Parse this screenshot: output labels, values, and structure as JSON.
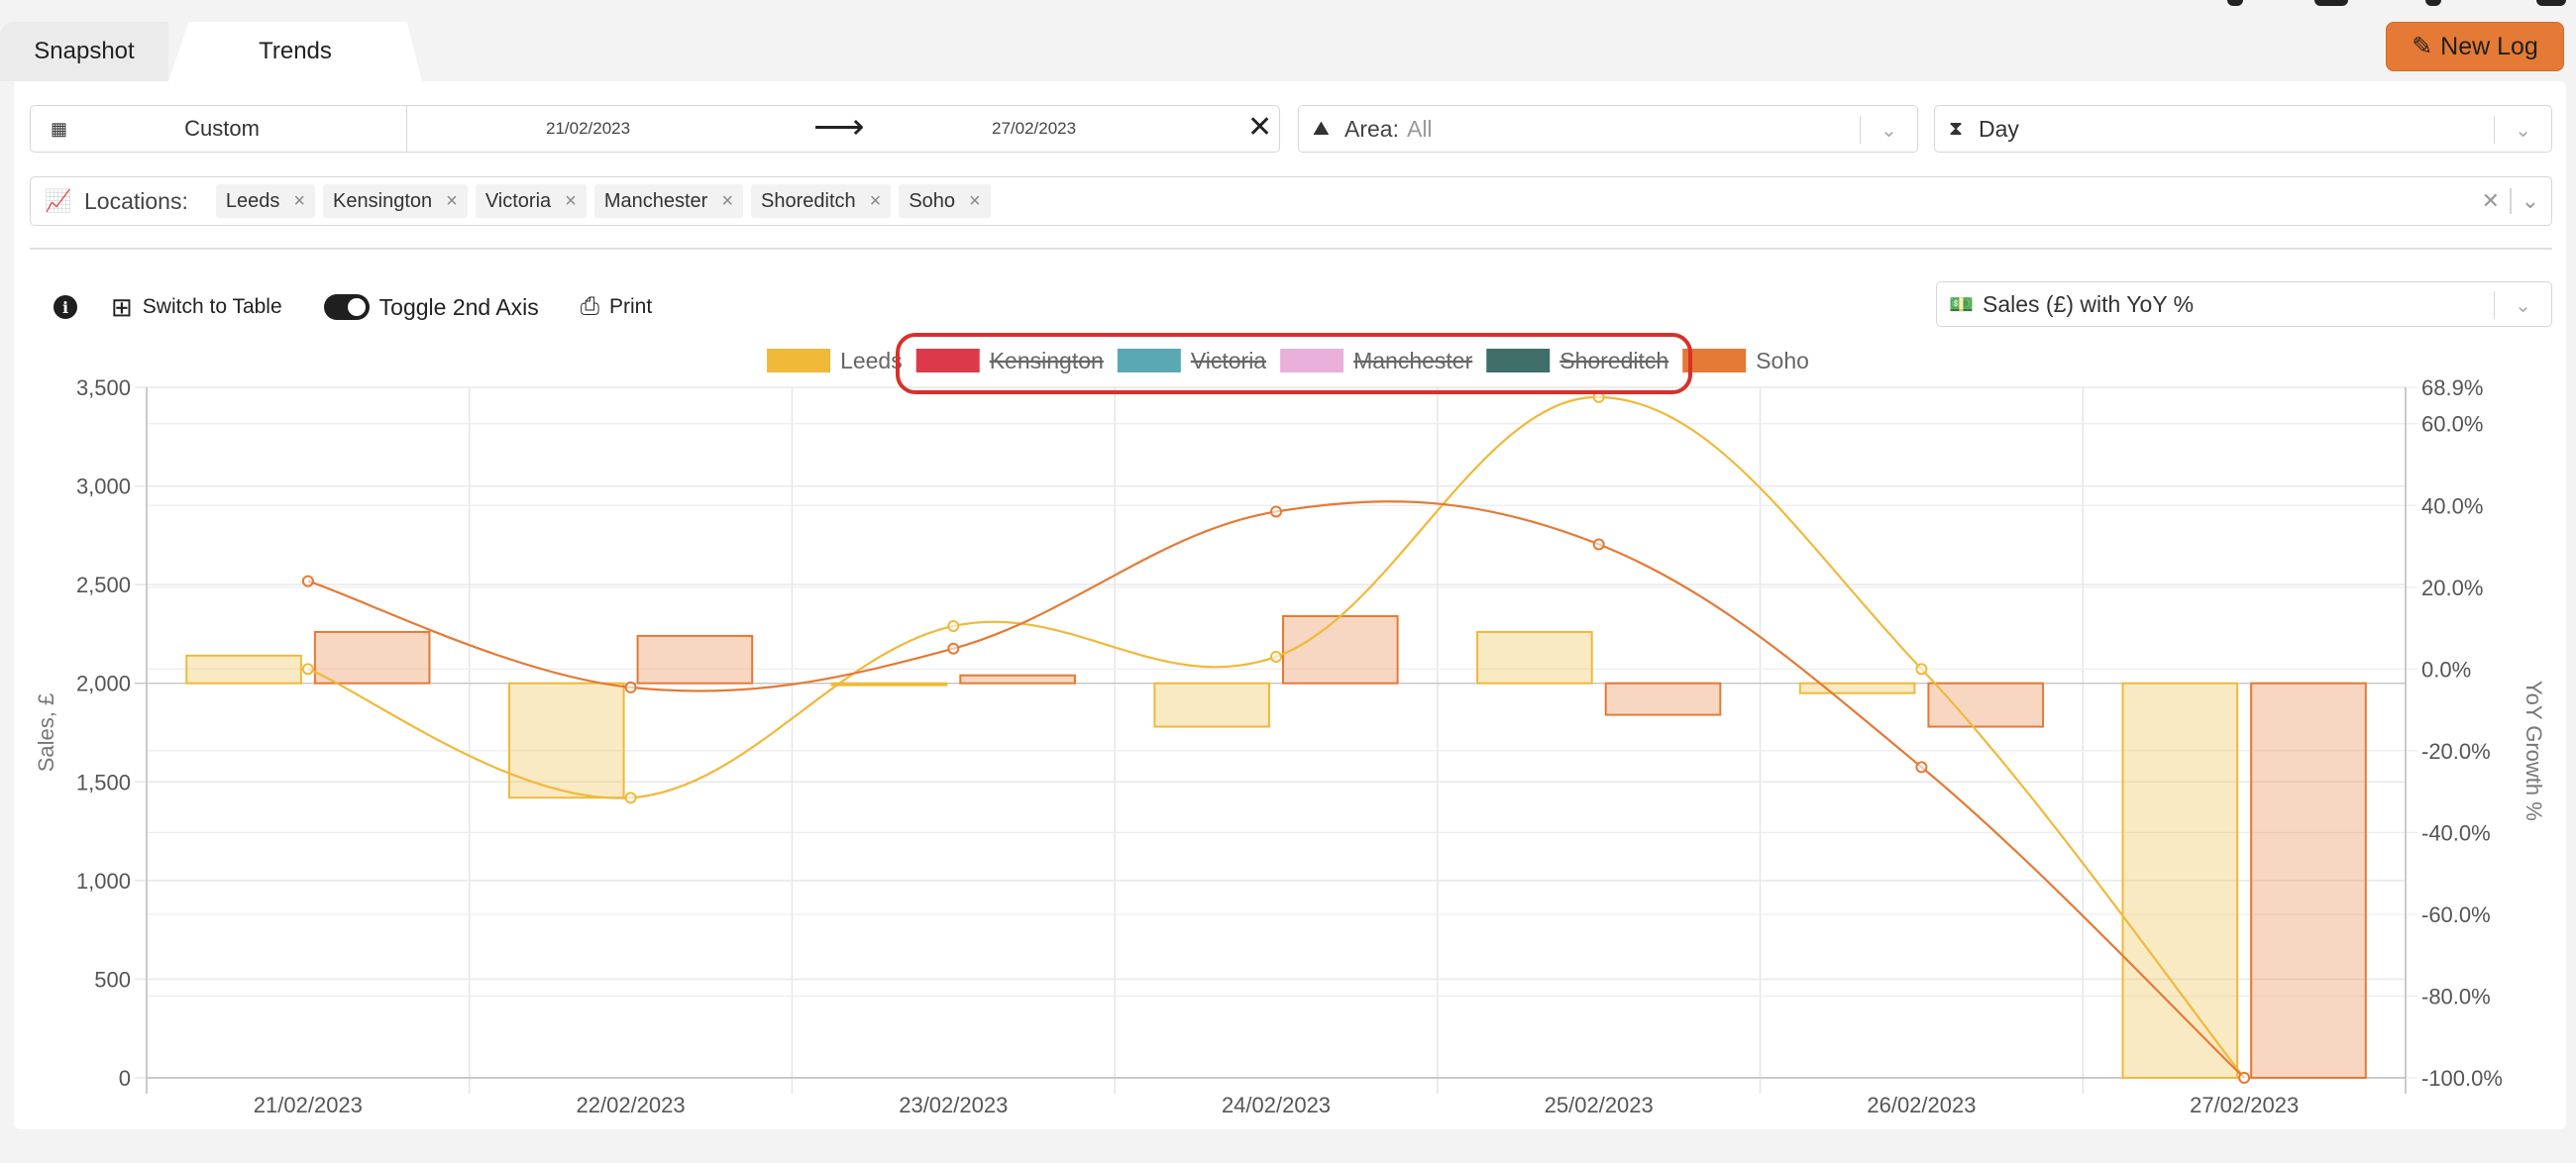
{
  "tabs": [
    {
      "label": "Snapshot"
    },
    {
      "label": "Trends"
    }
  ],
  "new_log_label": "New Log",
  "date_range": {
    "mode": "Custom",
    "from": "21/02/2023",
    "to": "27/02/2023"
  },
  "area": {
    "label": "Area:",
    "value": "All"
  },
  "interval": {
    "label": "Day"
  },
  "locations": {
    "label": "Locations:",
    "chips": [
      "Leeds",
      "Kensington",
      "Victoria",
      "Manchester",
      "Shoreditch",
      "Soho"
    ]
  },
  "toolbar": {
    "switch_table": "Switch to Table",
    "toggle_axis": "Toggle 2nd Axis",
    "print": "Print"
  },
  "metric": {
    "label": "Sales (£) with YoY %"
  },
  "chart_data": {
    "type": "bar",
    "categories": [
      "21/02/2023",
      "22/02/2023",
      "23/02/2023",
      "24/02/2023",
      "25/02/2023",
      "26/02/2023",
      "27/02/2023"
    ],
    "legend": [
      {
        "name": "Leeds",
        "color": "#f0b93a",
        "hidden": false
      },
      {
        "name": "Kensington",
        "color": "#dc3a4b",
        "hidden": true
      },
      {
        "name": "Victoria",
        "color": "#5aa8b4",
        "hidden": true
      },
      {
        "name": "Manchester",
        "color": "#e9b0dc",
        "hidden": true
      },
      {
        "name": "Shoreditch",
        "color": "#3f6e69",
        "hidden": true
      },
      {
        "name": "Soho",
        "color": "#e47a35",
        "hidden": false
      }
    ],
    "series": [
      {
        "name": "Leeds",
        "color": "#f0b93a",
        "bar_values": [
          2140,
          1420,
          1990,
          1780,
          2260,
          1950,
          0
        ],
        "yoy": [
          0.0,
          -31.5,
          10.5,
          3.0,
          66.5,
          0.0,
          -100.0
        ]
      },
      {
        "name": "Soho",
        "color": "#e47a35",
        "bar_values": [
          2260,
          2240,
          2040,
          2340,
          1840,
          1780,
          0
        ],
        "yoy": [
          21.5,
          -4.5,
          5.0,
          38.5,
          30.5,
          -24.0,
          -100.0
        ]
      }
    ],
    "bar_baseline": 2000,
    "y_left": {
      "label": "Sales, £",
      "min": 0,
      "max": 3500,
      "ticks": [
        "0",
        "500",
        "1,000",
        "1,500",
        "2,000",
        "2,500",
        "3,000",
        "3,500"
      ]
    },
    "y_right": {
      "label": "YoY Growth %",
      "min": -100,
      "max": 68.9,
      "ticks": [
        "-100.0%",
        "-80.0%",
        "-60.0%",
        "-40.0%",
        "-20.0%",
        "0.0%",
        "20.0%",
        "40.0%",
        "60.0%",
        "68.9%"
      ]
    },
    "grid": true,
    "legend_position": "top"
  }
}
